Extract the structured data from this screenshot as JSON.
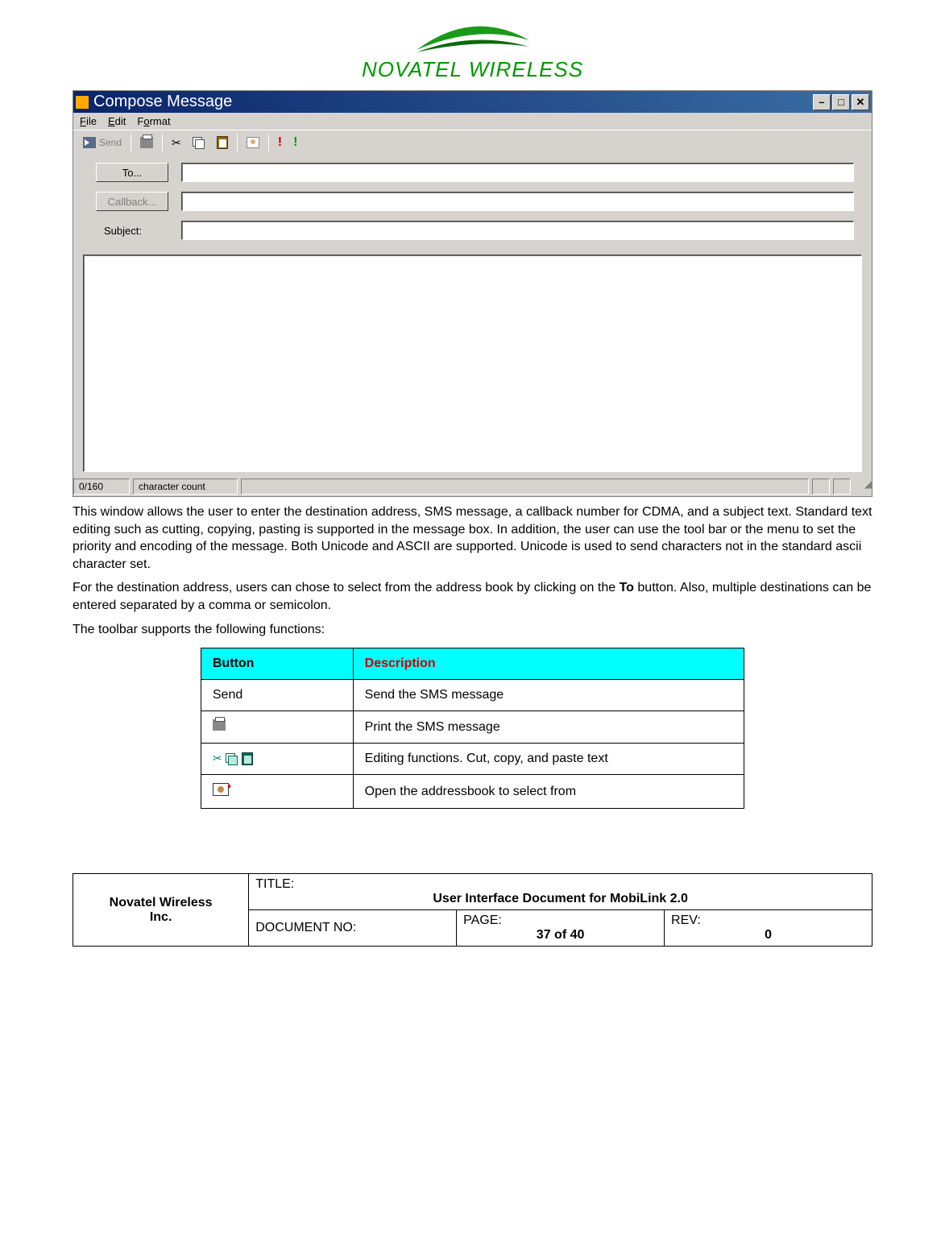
{
  "logo": {
    "brand": "NOVATEL WIRELESS"
  },
  "compose": {
    "title": "Compose Message",
    "menus": {
      "file": "File",
      "edit": "Edit",
      "format": "Format"
    },
    "toolbar": {
      "send": "Send"
    },
    "fields": {
      "to_label": "To...",
      "to_value": "",
      "callback_label": "Callback...",
      "callback_value": "",
      "subject_label": "Subject:",
      "subject_value": ""
    },
    "body": "",
    "status": {
      "count": "0/160",
      "label": "character count"
    }
  },
  "paragraphs": {
    "p1a": "This window allows the user to enter the destination address, SMS message, a callback number for CDMA, and a subject text.  Standard text editing such as cutting, copying, pasting is supported in the message box.  In addition, the user can use the tool bar or the menu to set the priority and encoding of the message.  Both Unicode and ASCII are supported.  Unicode is used to send characters not in the standard ascii character set.",
    "p2a": "For the destination address, users can chose to select from the address book by clicking on the ",
    "p2b": "To",
    "p2c": " button.  Also, multiple destinations can be entered separated by a comma or semicolon.",
    "p3": "The toolbar supports the following functions:"
  },
  "desc_table": {
    "headers": {
      "button": "Button",
      "description": "Description"
    },
    "rows": [
      {
        "button_text": "Send",
        "icon": "text",
        "desc": "Send the SMS message"
      },
      {
        "button_text": "",
        "icon": "print",
        "desc": "Print the SMS message"
      },
      {
        "button_text": "",
        "icon": "cutcopypaste",
        "desc": "Editing functions.  Cut, copy, and paste text"
      },
      {
        "button_text": "",
        "icon": "addressbook",
        "desc": "Open the addressbook to select from"
      }
    ]
  },
  "footer": {
    "org1": "Novatel Wireless",
    "org2": "Inc.",
    "title_label": "TITLE:",
    "title_value": "User Interface Document for MobiLink 2.0",
    "doc_label": "DOCUMENT NO:",
    "doc_value": "",
    "page_label": "PAGE:",
    "page_value": "37 of 40",
    "rev_label": "REV:",
    "rev_value": "0"
  }
}
